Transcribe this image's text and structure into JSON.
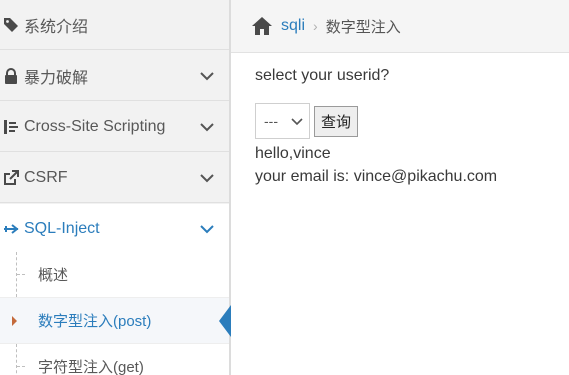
{
  "sidebar": {
    "items": [
      {
        "label": "系统介绍",
        "icon": "tag-icon"
      },
      {
        "label": "暴力破解",
        "icon": "lock-icon"
      },
      {
        "label": "Cross-Site Scripting",
        "icon": "sitemap-icon"
      },
      {
        "label": "CSRF",
        "icon": "external-link-icon"
      },
      {
        "label": "SQL-Inject",
        "icon": "plane-icon",
        "active": true
      }
    ],
    "subitems": [
      {
        "label": "概述"
      },
      {
        "label": "数字型注入(post)",
        "active": true
      },
      {
        "label": "字符型注入(get)"
      }
    ]
  },
  "breadcrumb": {
    "link": "sqli",
    "separator": "›",
    "current": "数字型注入"
  },
  "main": {
    "prompt": "select your userid?",
    "select_value": "---",
    "button_label": "查询",
    "result_line1": "hello,vince",
    "result_line2": "your email is: vince@pikachu.com"
  },
  "colors": {
    "accent": "#2b7dbc",
    "sidebar_bg": "#f2f2f2"
  }
}
